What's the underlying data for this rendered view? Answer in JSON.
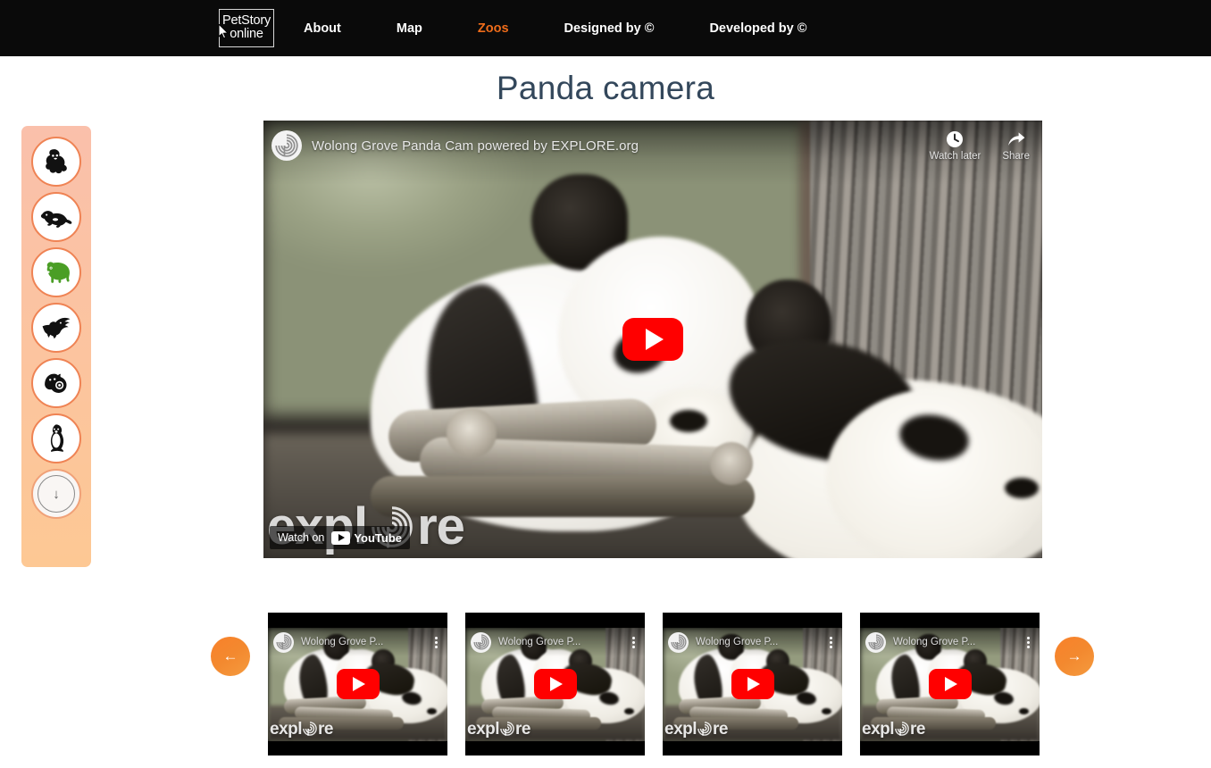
{
  "navbar": {
    "brand_line1": "PetStory",
    "brand_line2": "online",
    "cursor_icon": "mouse-cursor-icon",
    "links": [
      {
        "label": "About",
        "active": false
      },
      {
        "label": "Map",
        "active": false
      },
      {
        "label": "Zoos",
        "active": true
      },
      {
        "label": "Designed by ©",
        "active": false
      },
      {
        "label": "Developed by ©",
        "active": false
      }
    ],
    "background_color": "#0a0a0a",
    "active_color": "#ef6c1a",
    "text_color": "#ffffff"
  },
  "page": {
    "title": "Panda camera",
    "title_color": "#33475b",
    "background_color": "#ffffff"
  },
  "sidebar": {
    "background_from": "#fac0ab",
    "background_to": "#fdc894",
    "ring_color": "#ef8354",
    "active_icon_color": "#4a9e25",
    "items": [
      {
        "icon": "gorilla-icon",
        "label": "Gorilla",
        "active": false
      },
      {
        "icon": "komodo-dragon-icon",
        "label": "Komodo dragon",
        "active": false
      },
      {
        "icon": "panda-icon",
        "label": "Panda",
        "active": true
      },
      {
        "icon": "eagle-icon",
        "label": "Eagle",
        "active": false
      },
      {
        "icon": "sea-otter-icon",
        "label": "Sea otter",
        "active": false
      },
      {
        "icon": "penguin-icon",
        "label": "Penguin",
        "active": false
      }
    ],
    "scroll_button": {
      "icon": "arrow-down-icon",
      "label": "↓"
    }
  },
  "player": {
    "channel_avatar_icon": "explore-spiral-icon",
    "channel_title": "Wolong Grove Panda Cam powered by EXPLORE.org",
    "watch_later": {
      "label": "Watch later",
      "icon": "clock-icon"
    },
    "share": {
      "label": "Share",
      "icon": "share-arrow-icon"
    },
    "play_button_icon": "youtube-play-icon",
    "play_button_color": "#ff0000",
    "watermark_pre": "expl",
    "watermark_post": "re",
    "watch_on": {
      "prefix": "Watch on",
      "brand": "YouTube",
      "icon": "youtube-logo-icon"
    }
  },
  "carousel": {
    "prev_button": {
      "icon": "arrow-left-icon",
      "glyph": "←"
    },
    "next_button": {
      "icon": "arrow-right-icon",
      "glyph": "→"
    },
    "button_color": "#f3892f",
    "thumbnails": [
      {
        "title": "Wolong Grove P...",
        "watermark_pre": "expl",
        "watermark_post": "re",
        "menu_icon": "kebab-menu-icon",
        "play_icon": "youtube-play-icon"
      },
      {
        "title": "Wolong Grove P...",
        "watermark_pre": "expl",
        "watermark_post": "re",
        "menu_icon": "kebab-menu-icon",
        "play_icon": "youtube-play-icon"
      },
      {
        "title": "Wolong Grove P...",
        "watermark_pre": "expl",
        "watermark_post": "re",
        "menu_icon": "kebab-menu-icon",
        "play_icon": "youtube-play-icon"
      },
      {
        "title": "Wolong Grove P...",
        "watermark_pre": "expl",
        "watermark_post": "re",
        "menu_icon": "kebab-menu-icon",
        "play_icon": "youtube-play-icon"
      }
    ]
  }
}
